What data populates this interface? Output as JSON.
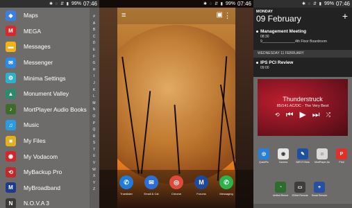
{
  "status_bar": {
    "icons": "✱ ◌ ⇵ ▮",
    "battery": "99%",
    "time": "07:46"
  },
  "drawer": {
    "apps": [
      {
        "name": "Maps",
        "icon": "maps-icon",
        "color": "#3b7fe0",
        "glyph": "◆"
      },
      {
        "name": "MEGA",
        "icon": "mega-icon",
        "color": "#d9272e",
        "glyph": "M"
      },
      {
        "name": "Messages",
        "icon": "messages-icon",
        "color": "#f2b21a",
        "glyph": "▬"
      },
      {
        "name": "Messenger",
        "icon": "messenger-icon",
        "color": "#2b8ce8",
        "glyph": "✉"
      },
      {
        "name": "Minima Settings",
        "icon": "minima-settings-icon",
        "color": "#2db3c9",
        "glyph": "⚙"
      },
      {
        "name": "Monument Valley",
        "icon": "monument-valley-icon",
        "color": "#2e8a6e",
        "glyph": "▲"
      },
      {
        "name": "MortPlayer Audio Books",
        "icon": "mortplayer-icon",
        "color": "#3f6b2a",
        "glyph": "♪"
      },
      {
        "name": "Music",
        "icon": "music-icon",
        "color": "#2c9be0",
        "glyph": "♫"
      },
      {
        "name": "My Files",
        "icon": "my-files-icon",
        "color": "#e3b11f",
        "glyph": "■"
      },
      {
        "name": "My Vodacom",
        "icon": "my-vodacom-icon",
        "color": "#d1262d",
        "glyph": "◉"
      },
      {
        "name": "MyBackup Pro",
        "icon": "mybackup-icon",
        "color": "#c02a2a",
        "glyph": "⟲"
      },
      {
        "name": "MyBroadband",
        "icon": "mybroadband-icon",
        "color": "#1f3a8c",
        "glyph": "M"
      },
      {
        "name": "N.O.V.A 3",
        "icon": "nova3-icon",
        "color": "#3a3a3a",
        "glyph": "N"
      }
    ],
    "alphabet": [
      "#",
      "A",
      "B",
      "C",
      "D",
      "E",
      "F",
      "G",
      "H",
      "I",
      "J",
      "K",
      "L",
      "M",
      "N",
      "O",
      "P",
      "Q",
      "R",
      "S",
      "T",
      "U",
      "V",
      "W",
      "X",
      "Y",
      "Z"
    ]
  },
  "home": {
    "dock": [
      {
        "label": "Truedialer",
        "icon": "truedialer-icon",
        "color": "#1e7be0",
        "glyph": "✆"
      },
      {
        "label": "Email & Cal",
        "icon": "email-icon",
        "color": "#2c6fd6",
        "glyph": "✉"
      },
      {
        "label": "Chrome",
        "icon": "chrome-icon",
        "color": "#e04a3a",
        "glyph": "◎"
      },
      {
        "label": "Forums",
        "icon": "forums-icon",
        "color": "#1d4a9e",
        "glyph": "M"
      },
      {
        "label": "Messaging",
        "icon": "messaging-icon",
        "color": "#2bb34c",
        "glyph": "✆"
      }
    ],
    "edge_left_label": "Messaging",
    "edge_right_label": ""
  },
  "calendar": {
    "weekday": "MONDAY",
    "date": "09 February",
    "events": [
      {
        "title": "Management Meeting",
        "time": "08:30",
        "location": "9_________________4th Floor Boardroom"
      },
      {
        "title": "IPS PCI Review",
        "time": "09:00",
        "location": ""
      }
    ],
    "divider": "WEDNESDAY 11 FEBRUARY"
  },
  "music": {
    "title": "Thunderstruck",
    "subtitle": "85/141  AC/DC - The Very Best"
  },
  "widgets_grid": [
    {
      "label": "QuickPic",
      "icon": "quickpic-icon",
      "color": "#2a7ed6",
      "glyph": "◎"
    },
    {
      "label": "Camera",
      "icon": "camera-icon",
      "color": "#e6e6e6",
      "glyph": "◉"
    },
    {
      "label": "WiFi-Fi Beta",
      "icon": "wifi-beta-icon",
      "color": "#1f4fa0",
      "glyph": "✎"
    },
    {
      "label": "MortPlayer Au",
      "icon": "mortplayer-small-icon",
      "color": "#d9d9d9",
      "glyph": "☺"
    },
    {
      "label": "Print",
      "icon": "print-icon",
      "color": "#e0302a",
      "glyph": "P"
    },
    {
      "label": "Unified Remot",
      "icon": "unified-remote-icon",
      "color": "#2e6b2e",
      "glyph": "◔"
    },
    {
      "label": "ZDNet Remote",
      "icon": "zdnet-icon",
      "color": "#3d3d3d",
      "glyph": "▭"
    },
    {
      "label": "Smart Remote",
      "icon": "smart-remote-icon",
      "color": "#2a4fa0",
      "glyph": "+"
    }
  ]
}
